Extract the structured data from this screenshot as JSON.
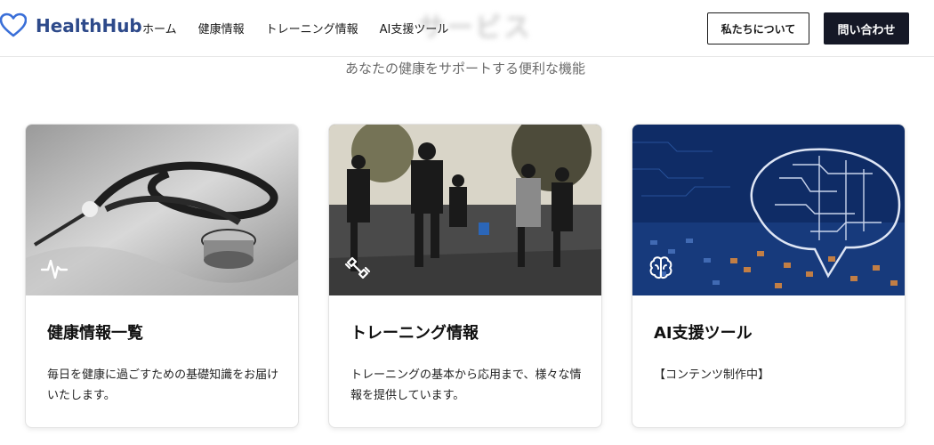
{
  "header": {
    "brand": "HealthHub",
    "nav": [
      "ホーム",
      "健康情報",
      "トレーニング情報",
      "AI支援ツール"
    ],
    "about_label": "私たちについて",
    "contact_label": "問い合わせ"
  },
  "section": {
    "title": "サービス",
    "subtitle": "あなたの健康をサポートする便利な機能"
  },
  "cards": [
    {
      "title": "健康情報一覧",
      "description": "毎日を健康に過ごすための基礎知識をお届けいたします。",
      "icon": "heartbeat-icon"
    },
    {
      "title": "トレーニング情報",
      "description": "トレーニングの基本から応用まで、様々な情報を提供しています。",
      "icon": "dumbbell-icon"
    },
    {
      "title": "AI支援ツール",
      "description": "【コンテンツ制作中】",
      "icon": "brain-icon"
    }
  ],
  "colors": {
    "brand": "#2e4a8a",
    "heart": "#3a6fd8",
    "contact_bg": "#151826"
  }
}
